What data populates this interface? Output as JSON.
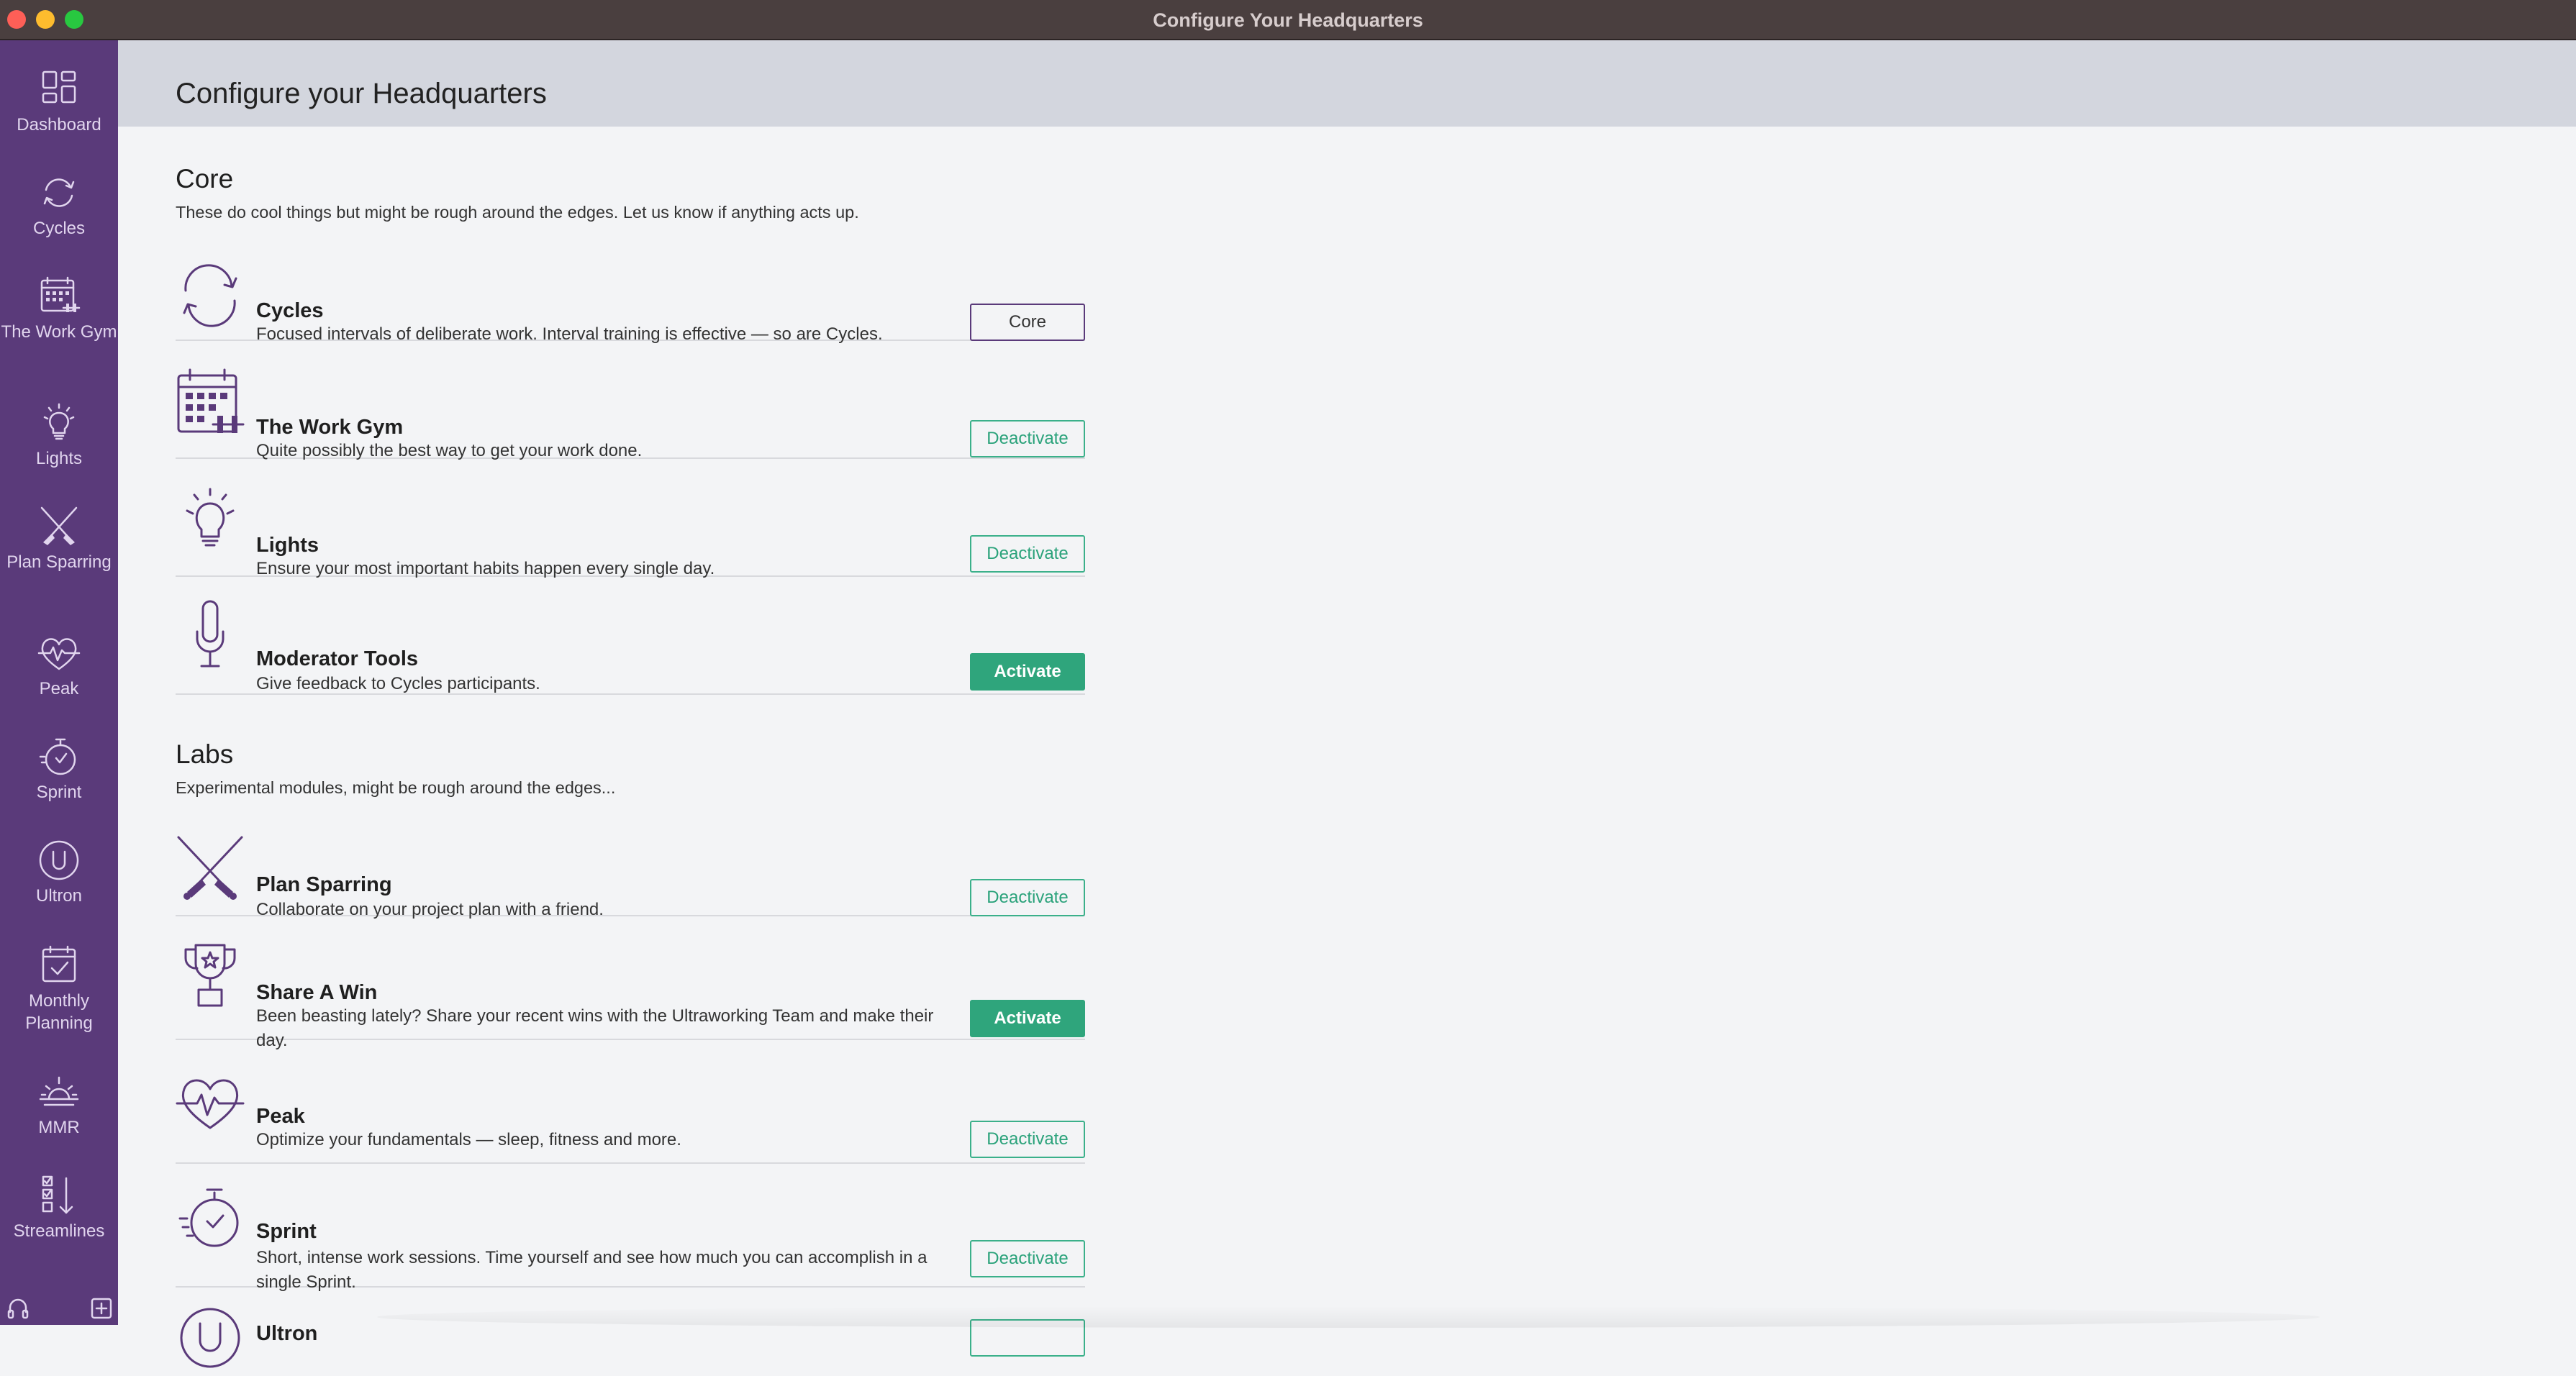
{
  "window": {
    "title": "Configure Your Headquarters"
  },
  "sidebar": {
    "items": [
      {
        "label": "Dashboard",
        "icon": "dashboard-icon"
      },
      {
        "label": "Cycles",
        "icon": "cycles-icon"
      },
      {
        "label": "The Work Gym",
        "icon": "calendar-dumbbell-icon"
      },
      {
        "label": "Lights",
        "icon": "lightbulb-icon"
      },
      {
        "label": "Plan Sparring",
        "icon": "crossed-swords-icon"
      },
      {
        "label": "Peak",
        "icon": "heartbeat-icon"
      },
      {
        "label": "Sprint",
        "icon": "stopwatch-icon"
      },
      {
        "label": "Ultron",
        "icon": "ultron-icon"
      },
      {
        "label": "Monthly Planning",
        "icon": "calendar-check-icon"
      },
      {
        "label": "MMR",
        "icon": "sunrise-icon"
      },
      {
        "label": "Streamlines",
        "icon": "checklist-icon"
      }
    ],
    "bottom_left_icon": "headphones-icon",
    "bottom_right_icon": "add-icon"
  },
  "page": {
    "title": "Configure your Headquarters"
  },
  "core": {
    "title": "Core",
    "description": "These do cool things but might be rough around the edges. Let us know if anything acts up.",
    "modules": [
      {
        "name": "Cycles",
        "description": "Focused intervals of deliberate work. Interval training is effective — so are Cycles.",
        "button": "Core",
        "state": "core",
        "icon": "cycles-icon"
      },
      {
        "name": "The Work Gym",
        "description": "Quite possibly the best way to get your work done.",
        "button": "Deactivate",
        "state": "active",
        "icon": "calendar-dumbbell-icon"
      },
      {
        "name": "Lights",
        "description": "Ensure your most important habits happen every single day.",
        "button": "Deactivate",
        "state": "active",
        "icon": "lightbulb-icon"
      },
      {
        "name": "Moderator Tools",
        "description": "Give feedback to Cycles participants.",
        "button": "Activate",
        "state": "inactive",
        "icon": "microphone-icon"
      }
    ]
  },
  "labs": {
    "title": "Labs",
    "description": "Experimental modules, might be rough around the edges...",
    "modules": [
      {
        "name": "Plan Sparring",
        "description": "Collaborate on your project plan with a friend.",
        "button": "Deactivate",
        "state": "active",
        "icon": "crossed-swords-icon"
      },
      {
        "name": "Share A Win",
        "description": "Been beasting lately? Share your recent wins with the Ultraworking Team and make their day.",
        "button": "Activate",
        "state": "inactive",
        "icon": "trophy-icon"
      },
      {
        "name": "Peak",
        "description": "Optimize your fundamentals — sleep, fitness and more.",
        "button": "Deactivate",
        "state": "active",
        "icon": "heartbeat-icon"
      },
      {
        "name": "Sprint",
        "description": "Short, intense work sessions. Time yourself and see how much you can accomplish in a single Sprint.",
        "button": "Deactivate",
        "state": "active",
        "icon": "stopwatch-icon"
      },
      {
        "name": "Ultron",
        "description": "",
        "button": "",
        "state": "active",
        "icon": "ultron-icon"
      }
    ]
  },
  "colors": {
    "sidebar": "#5a3a7a",
    "accent_green": "#2fa57c",
    "header_bg": "#d3d6de",
    "titlebar": "#4a3f3f"
  }
}
